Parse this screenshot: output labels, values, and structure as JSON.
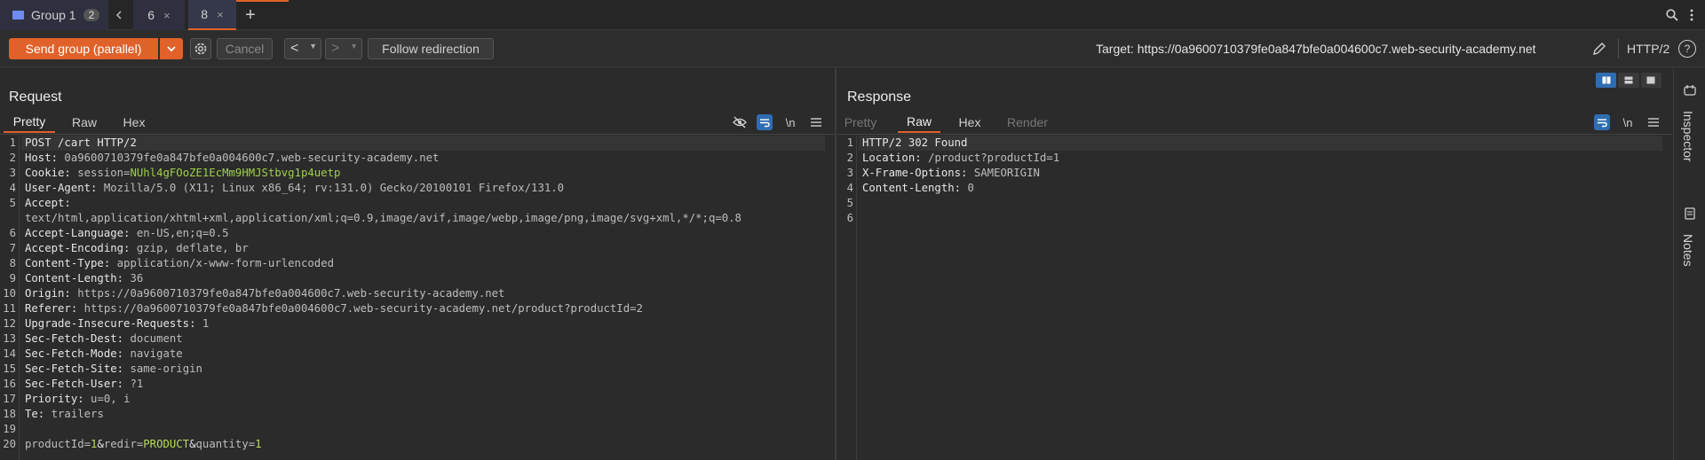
{
  "tabs": {
    "group_label": "Group 1",
    "group_count": "2",
    "tab6": "6",
    "tab8": "8",
    "close": "×",
    "add": "+"
  },
  "toolbar": {
    "send_label": "Send group (parallel)",
    "cancel_label": "Cancel",
    "back": "<",
    "forward": ">",
    "follow_label": "Follow redirection",
    "target_label": "Target: https://0a9600710379fe0a847bfe0a004600c7.web-security-academy.net",
    "http_version": "HTTP/2"
  },
  "request": {
    "title": "Request",
    "tabs": [
      "Pretty",
      "Raw",
      "Hex"
    ],
    "active_tab": "Pretty",
    "newline_label": "\\n",
    "lines": [
      {
        "n": "1",
        "name": "POST /cart HTTP/2",
        "value": ""
      },
      {
        "n": "2",
        "name": "Host: ",
        "value": "0a9600710379fe0a847bfe0a004600c7.web-security-academy.net"
      },
      {
        "n": "3",
        "name": "Cookie: ",
        "value": "session=NUhl4gFOoZE1EcMm9HMJStbvg1p4uetp"
      },
      {
        "n": "4",
        "name": "User-Agent: ",
        "value": "Mozilla/5.0 (X11; Linux x86_64; rv:131.0) Gecko/20100101 Firefox/131.0"
      },
      {
        "n": "5",
        "name": "Accept:",
        "value": ""
      },
      {
        "n": "",
        "name": "",
        "value": "text/html,application/xhtml+xml,application/xml;q=0.9,image/avif,image/webp,image/png,image/svg+xml,*/*;q=0.8"
      },
      {
        "n": "6",
        "name": "Accept-Language: ",
        "value": "en-US,en;q=0.5"
      },
      {
        "n": "7",
        "name": "Accept-Encoding: ",
        "value": "gzip, deflate, br"
      },
      {
        "n": "8",
        "name": "Content-Type: ",
        "value": "application/x-www-form-urlencoded"
      },
      {
        "n": "9",
        "name": "Content-Length: ",
        "value": "36"
      },
      {
        "n": "10",
        "name": "Origin: ",
        "value": "https://0a9600710379fe0a847bfe0a004600c7.web-security-academy.net"
      },
      {
        "n": "11",
        "name": "Referer: ",
        "value": "https://0a9600710379fe0a847bfe0a004600c7.web-security-academy.net/product?productId=2"
      },
      {
        "n": "12",
        "name": "Upgrade-Insecure-Requests: ",
        "value": "1"
      },
      {
        "n": "13",
        "name": "Sec-Fetch-Dest: ",
        "value": "document"
      },
      {
        "n": "14",
        "name": "Sec-Fetch-Mode: ",
        "value": "navigate"
      },
      {
        "n": "15",
        "name": "Sec-Fetch-Site: ",
        "value": "same-origin"
      },
      {
        "n": "16",
        "name": "Sec-Fetch-User: ",
        "value": "?1"
      },
      {
        "n": "17",
        "name": "Priority: ",
        "value": "u=0, i"
      },
      {
        "n": "18",
        "name": "Te: ",
        "value": "trailers"
      },
      {
        "n": "19",
        "name": "",
        "value": ""
      },
      {
        "n": "20",
        "name": "",
        "value": "productId=1&redir=PRODUCT&quantity=1"
      }
    ]
  },
  "response": {
    "title": "Response",
    "tabs": [
      "Pretty",
      "Raw",
      "Hex",
      "Render"
    ],
    "active_tab": "Raw",
    "newline_label": "\\n",
    "lines": [
      {
        "n": "1",
        "name": "HTTP/2 302 Found",
        "value": ""
      },
      {
        "n": "2",
        "name": "Location: ",
        "value": "/product?productId=1"
      },
      {
        "n": "3",
        "name": "X-Frame-Options: ",
        "value": "SAMEORIGIN"
      },
      {
        "n": "4",
        "name": "Content-Length: ",
        "value": "0"
      },
      {
        "n": "5",
        "name": "",
        "value": ""
      },
      {
        "n": "6",
        "name": "",
        "value": ""
      }
    ]
  },
  "sidebar": {
    "inspector_label": "Inspector",
    "notes_label": "Notes"
  },
  "colors": {
    "accent_orange": "#e0622a",
    "blue_active": "#2f6db3",
    "cookie_green": "#9fd04a"
  }
}
